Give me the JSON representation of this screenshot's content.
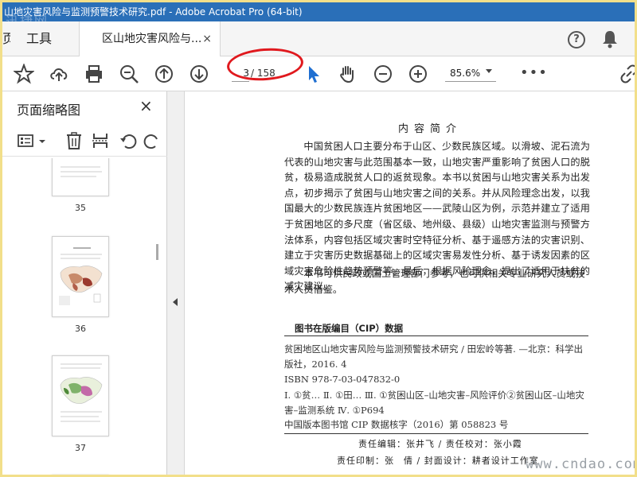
{
  "window": {
    "title": "山地灾害风险与监测预警技术研究.pdf - Adobe Acrobat Pro (64-bit)",
    "watermark": "迅捷网"
  },
  "tabs": {
    "home_partial": "页",
    "tools": "工具",
    "document": "区山地灾害风险与...",
    "close": "×"
  },
  "toolbar": {
    "current_page": "3",
    "total_pages": "/ 158",
    "zoom": "85.6%",
    "more": "•••"
  },
  "colors": {
    "titlebar": "#2a6fb8",
    "annotation_oval": "#e0191e",
    "select_cursor": "#1f6fd1"
  },
  "panel": {
    "title": "页面缩略图",
    "close": "×",
    "thumbnails": [
      {
        "label": "35"
      },
      {
        "label": "36"
      },
      {
        "label": "37"
      }
    ]
  },
  "document": {
    "heading": "内容简介",
    "paragraph1": "中国贫困人口主要分布于山区、少数民族区域。以滑坡、泥石流为代表的山地灾害与此范围基本一致，山地灾害严重影响了贫困人口的脱贫，极易造成脱贫人口的返贫现象。本书以贫困与山地灾害关系为出发点，初步揭示了贫困与山地灾害之间的关系。并从风险理念出发，以我国最大的少数民族连片贫困地区——武陵山区为例，示范并建立了适用于贫困地区的多尺度（省区级、地州级、县级）山地灾害监测与预警方法体系，内容包括区域灾害时空特征分析、基于遥感方法的灾害识别、建立于灾害历史数据基础上的区域灾害易发性分析、基于诱发因素的区域灾害危险性趋势预警等。最后，根据风险理念，提出了适用于扶贫的减灾建议。",
    "paragraph2": "本书可供民政或国土管理部门参考，也可供相关专业研究人员或技术人员借鉴。",
    "cip_title": "图书在版编目（CIP）数据",
    "cip_line1": "贫困地区山地灾害风险与监测预警技术研究 / 田宏岭等著. —北京：科学出版社，2016. 4",
    "cip_isbn": "ISBN 978-7-03-047832-0",
    "cip_class": "Ⅰ. ①贫…    Ⅱ. ①田…    Ⅲ. ①贫困山区–山地灾害–风险评价②贫困山区–山地灾害–监测系统    Ⅳ. ①P694",
    "cip_number": "中国版本图书馆 CIP 数据核字（2016）第 058823 号",
    "credits1": "责任编辑：张井飞 / 责任校对：张小霞",
    "credits2": "责任印制：张　倩 / 封面设计：耕者设计工作室",
    "watermark": "www.cndao.com"
  }
}
